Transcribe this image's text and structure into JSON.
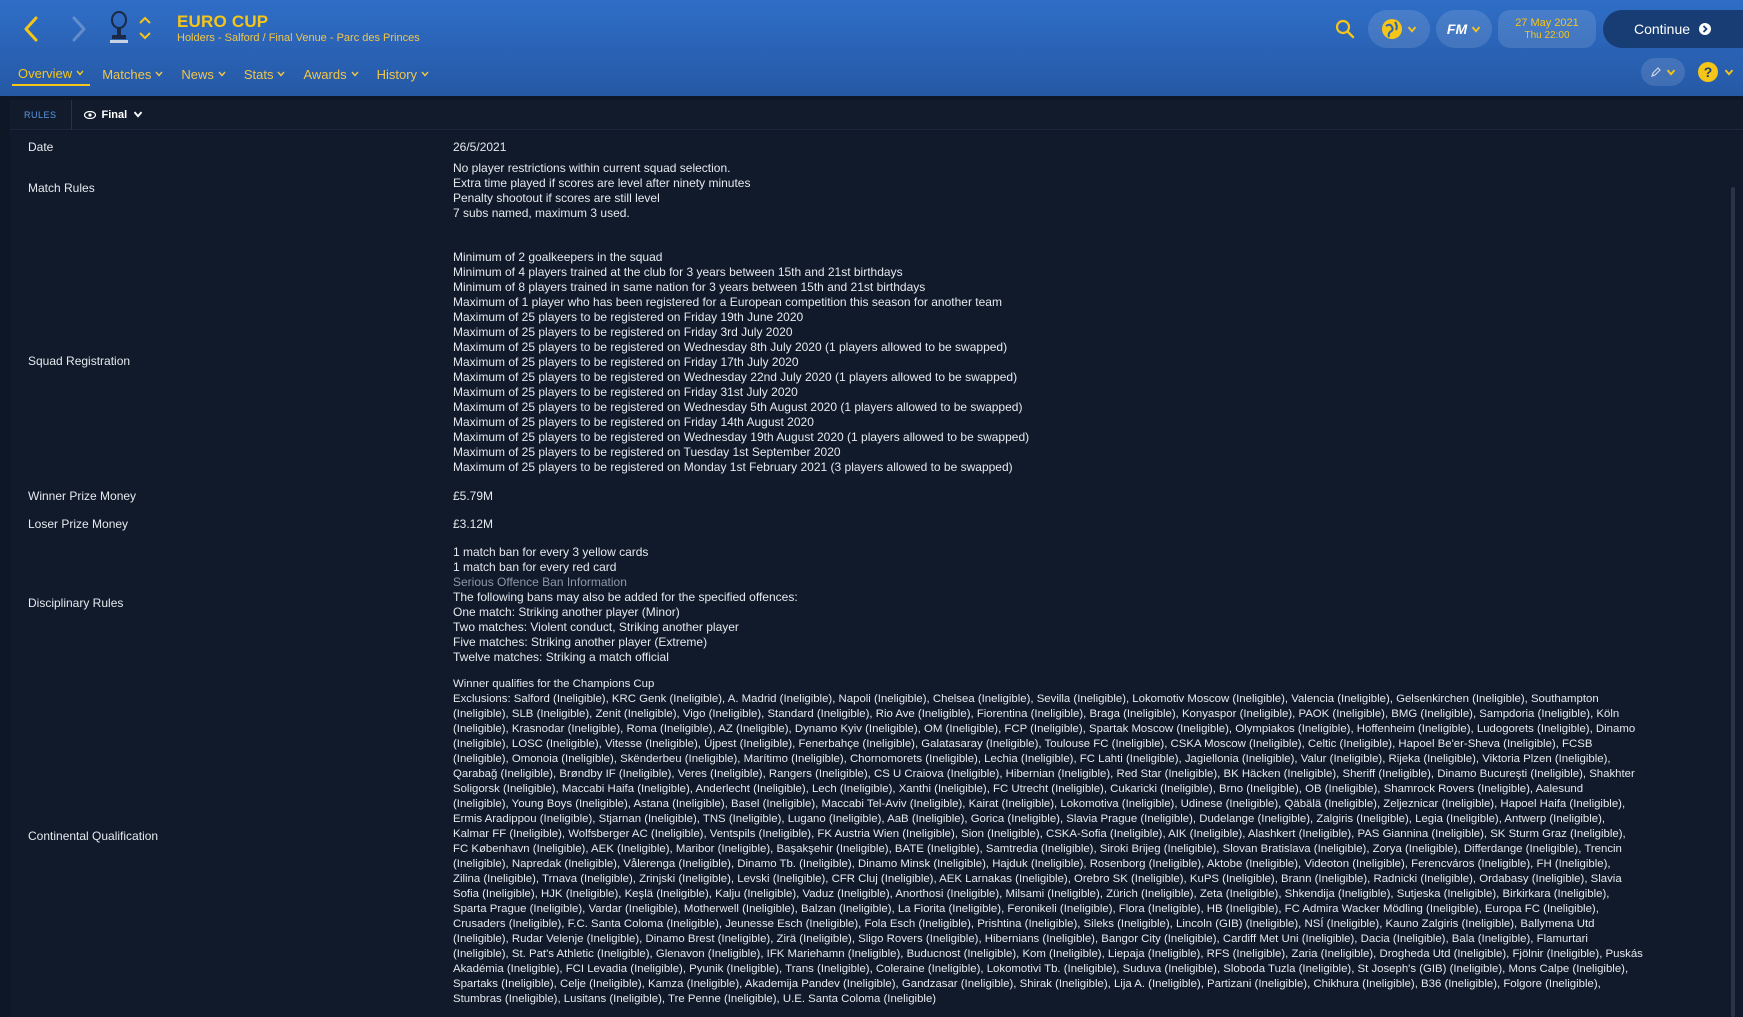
{
  "header": {
    "title": "EURO CUP",
    "subtitle": "Holders - Salford / Final Venue - Parc des Princes",
    "date": "27 May 2021",
    "day_time": "Thu 22:00",
    "continue_label": "Continue",
    "fm_label": "FM",
    "help_label": "?"
  },
  "menu": [
    {
      "label": "Overview",
      "active": true
    },
    {
      "label": "Matches"
    },
    {
      "label": "News"
    },
    {
      "label": "Stats"
    },
    {
      "label": "Awards"
    },
    {
      "label": "History"
    }
  ],
  "subbar": {
    "tab_label": "RULES",
    "stage_select": "Final"
  },
  "rules": {
    "date": {
      "label": "Date",
      "value": "26/5/2021"
    },
    "match_rules": {
      "label": "Match Rules",
      "lines": [
        "No player restrictions within current squad selection.",
        "Extra time played if scores are level after ninety minutes",
        "Penalty shootout if scores are still level",
        "7 subs named, maximum 3 used."
      ]
    },
    "squad_registration": {
      "label": "Squad Registration",
      "lines": [
        "Minimum of 2 goalkeepers in the squad",
        "Minimum of 4 players trained at the club for 3 years between 15th and 21st birthdays",
        "Minimum of 8 players trained in same nation for 3 years between 15th and 21st birthdays",
        "Maximum of 1 player who has been registered for a European competition this season for another team",
        "Maximum of 25 players to be registered on Friday 19th June 2020",
        "Maximum of 25 players to be registered on Friday 3rd July 2020",
        "Maximum of 25 players to be registered on Wednesday 8th July 2020 (1 players allowed to be swapped)",
        "Maximum of 25 players to be registered on Friday 17th July 2020",
        "Maximum of 25 players to be registered on Wednesday 22nd July 2020 (1 players allowed to be swapped)",
        "Maximum of 25 players to be registered on Friday 31st July 2020",
        "Maximum of 25 players to be registered on Wednesday 5th August 2020 (1 players allowed to be swapped)",
        "Maximum of 25 players to be registered on Friday 14th August 2020",
        "Maximum of 25 players to be registered on Wednesday 19th August 2020 (1 players allowed to be swapped)",
        "Maximum of 25 players to be registered on Tuesday 1st September 2020",
        "Maximum of 25 players to be registered on Monday 1st February 2021 (3 players allowed to be swapped)"
      ]
    },
    "winner_prize": {
      "label": "Winner Prize Money",
      "value": "£5.79M"
    },
    "loser_prize": {
      "label": "Loser Prize Money",
      "value": "£3.12M"
    },
    "disciplinary": {
      "label": "Disciplinary Rules",
      "lines": [
        "1 match ban for every 3 yellow cards",
        "1 match ban for every red card",
        "Serious Offence Ban Information",
        "The following bans may also be added for the specified offences:",
        "One match: Striking another player (Minor)",
        "Two matches: Violent conduct, Striking another player",
        "Five matches: Striking another player (Extreme)",
        "Twelve matches: Striking a match official"
      ]
    },
    "continental": {
      "label": "Continental Qualification",
      "lines": [
        "Winner qualifies for the Champions Cup",
        "Exclusions: Salford (Ineligible), KRC Genk (Ineligible), A. Madrid (Ineligible), Napoli (Ineligible), Chelsea (Ineligible), Sevilla (Ineligible), Lokomotiv Moscow (Ineligible), Valencia (Ineligible), Gelsenkirchen (Ineligible), Southampton",
        "(Ineligible), SLB (Ineligible), Zenit (Ineligible), Vigo (Ineligible), Standard (Ineligible), Rio Ave (Ineligible), Fiorentina (Ineligible), Braga (Ineligible), Konyaspor (Ineligible), PAOK (Ineligible), BMG (Ineligible), Sampdoria (Ineligible), Köln",
        "(Ineligible), Krasnodar (Ineligible), Roma (Ineligible), AZ (Ineligible), Dynamo Kyiv (Ineligible), OM (Ineligible), FCP (Ineligible), Spartak Moscow (Ineligible), Olympiakos (Ineligible), Hoffenheim (Ineligible), Ludogorets (Ineligible), Dinamo",
        "(Ineligible), LOSC (Ineligible), Vitesse (Ineligible), Újpest (Ineligible), Fenerbahçe (Ineligible), Galatasaray (Ineligible), Toulouse FC (Ineligible), CSKA Moscow (Ineligible), Celtic (Ineligible), Hapoel Be'er-Sheva (Ineligible), FCSB",
        "(Ineligible), Omonoia (Ineligible), Skënderbeu (Ineligible), Marítimo (Ineligible), Chornomorets (Ineligible), Lechia (Ineligible), FC Lahti (Ineligible), Jagiellonia (Ineligible), Valur (Ineligible), Rijeka (Ineligible), Viktoria Plzen (Ineligible),",
        "Qarabağ (Ineligible), Brøndby IF (Ineligible), Veres (Ineligible), Rangers (Ineligible), CS U Craiova (Ineligible), Hibernian (Ineligible), Red Star (Ineligible), BK Häcken (Ineligible), Sheriff (Ineligible), Dinamo Bucureşti (Ineligible), Shakhter",
        "Soligorsk (Ineligible), Maccabi Haifa (Ineligible), Anderlecht (Ineligible), Lech (Ineligible), Xanthi (Ineligible), FC Utrecht (Ineligible), Cukaricki (Ineligible), Brno (Ineligible), OB (Ineligible), Shamrock Rovers (Ineligible), Aalesund",
        "(Ineligible), Young Boys (Ineligible), Astana (Ineligible), Basel (Ineligible), Maccabi Tel-Aviv (Ineligible), Kairat (Ineligible), Lokomotiva (Ineligible), Udinese (Ineligible), Qäbälä (Ineligible), Zeljeznicar (Ineligible), Hapoel Haifa (Ineligible),",
        "Ermis Aradippou (Ineligible), Stjarnan (Ineligible), TNS (Ineligible), Lugano (Ineligible), AaB (Ineligible), Gorica (Ineligible), Slavia Prague (Ineligible), Dudelange (Ineligible), Zalgiris (Ineligible), Legia (Ineligible), Antwerp (Ineligible),",
        "Kalmar FF (Ineligible), Wolfsberger AC (Ineligible), Ventspils (Ineligible), FK Austria Wien (Ineligible), Sion (Ineligible), CSKA-Sofia (Ineligible), AIK (Ineligible), Alashkert (Ineligible), PAS Giannina (Ineligible), SK Sturm Graz (Ineligible),",
        "FC København (Ineligible), AEK (Ineligible), Maribor (Ineligible), Başakşehir (Ineligible), BATE (Ineligible), Samtredia (Ineligible), Siroki Brijeg (Ineligible), Slovan Bratislava (Ineligible), Zorya (Ineligible), Differdange (Ineligible), Trencin",
        "(Ineligible), Napredak (Ineligible), Vålerenga (Ineligible), Dinamo Tb. (Ineligible), Dinamo Minsk (Ineligible), Hajduk (Ineligible), Rosenborg (Ineligible), Aktobe (Ineligible), Videoton (Ineligible), Ferencváros (Ineligible), FH (Ineligible),",
        "Zilina (Ineligible), Trnava (Ineligible), Zrinjski (Ineligible), Levski (Ineligible), CFR Cluj (Ineligible), AEK Larnakas (Ineligible), Orebro SK (Ineligible), KuPS (Ineligible), Brann (Ineligible), Radnicki (Ineligible), Ordabasy (Ineligible), Slavia",
        "Sofia (Ineligible), HJK (Ineligible), Keşlä (Ineligible), Kalju (Ineligible), Vaduz (Ineligible), Anorthosi (Ineligible), Milsami (Ineligible), Zürich (Ineligible), Zeta (Ineligible), Shkendija (Ineligible), Sutjeska (Ineligible), Birkirkara (Ineligible),",
        "Sparta Prague (Ineligible), Vardar (Ineligible), Motherwell (Ineligible), Balzan (Ineligible), La Fiorita (Ineligible), Feronikeli (Ineligible), Flora (Ineligible), HB (Ineligible), FC Admira Wacker Mödling (Ineligible), Europa FC (Ineligible),",
        "Crusaders (Ineligible), F.C. Santa Coloma (Ineligible), Jeunesse Esch (Ineligible), Fola Esch (Ineligible), Prishtina (Ineligible), Sileks (Ineligible), Lincoln (GIB) (Ineligible), NSÍ (Ineligible), Kauno Zalgiris (Ineligible), Ballymena Utd",
        "(Ineligible), Rudar Velenje (Ineligible), Dinamo Brest (Ineligible), Zirä (Ineligible), Sligo Rovers (Ineligible), Hibernians (Ineligible), Bangor City (Ineligible), Cardiff Met Uni (Ineligible), Dacia (Ineligible), Bala (Ineligible), Flamurtari",
        "(Ineligible), St. Pat's Athletic (Ineligible), Glenavon (Ineligible), IFK Mariehamn (Ineligible), Buducnost (Ineligible), Kom (Ineligible), Liepaja (Ineligible), RFS (Ineligible), Zaria (Ineligible), Drogheda Utd (Ineligible), Fjölnir (Ineligible), Puskás",
        "Akadémia (Ineligible), FCI Levadia (Ineligible), Pyunik (Ineligible), Trans (Ineligible), Coleraine (Ineligible), Lokomotivi Tb. (Ineligible), Suduva (Ineligible), Sloboda Tuzla (Ineligible), St Joseph's (GIB) (Ineligible), Mons Calpe (Ineligible),",
        "Spartaks (Ineligible), Celje (Ineligible), Kamza (Ineligible), Akademija Pandev (Ineligible), Gandzasar (Ineligible), Shirak (Ineligible), Lija A. (Ineligible), Partizani (Ineligible), Chikhura (Ineligible), B36 (Ineligible), Folgore (Ineligible),",
        "Stumbras (Ineligible), Lusitans (Ineligible), Tre Penne (Ineligible), U.E. Santa Coloma (Ineligible)"
      ]
    }
  },
  "colors": {
    "header_blue": "#2a62b4",
    "accent_yellow": "#f5c518",
    "panel_bg": "#101a2a",
    "link_blue": "#5e9ae6"
  }
}
